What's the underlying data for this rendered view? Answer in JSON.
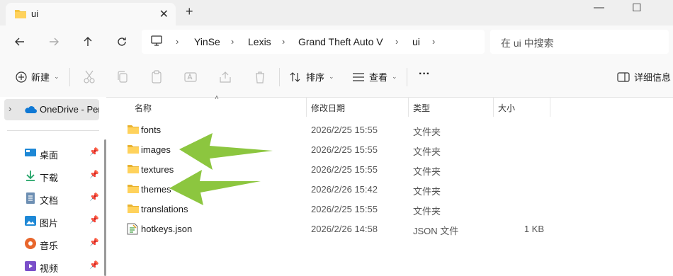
{
  "window": {
    "tab_title": "ui",
    "new_tab": "+",
    "minimize": "—",
    "maximize": "☐"
  },
  "nav": {
    "breadcrumbs": [
      "YinSe",
      "Lexis",
      "Grand Theft Auto V",
      "ui"
    ],
    "search_placeholder": "在 ui 中搜索"
  },
  "toolbar": {
    "new_label": "新建",
    "sort_label": "排序",
    "view_label": "查看",
    "more_label": "···",
    "details_label": "详细信息"
  },
  "sidebar": {
    "onedrive": "OneDrive - Per",
    "items": [
      {
        "label": "桌面",
        "icon": "desktop-icon"
      },
      {
        "label": "下载",
        "icon": "download-icon"
      },
      {
        "label": "文档",
        "icon": "document-icon"
      },
      {
        "label": "图片",
        "icon": "pictures-icon"
      },
      {
        "label": "音乐",
        "icon": "music-icon"
      },
      {
        "label": "视频",
        "icon": "video-icon"
      }
    ]
  },
  "columns": {
    "name": "名称",
    "modified": "修改日期",
    "type": "类型",
    "size": "大小"
  },
  "files": [
    {
      "name": "fonts",
      "modified": "2026/2/25 15:55",
      "type": "文件夹",
      "size": "",
      "icon": "folder-icon"
    },
    {
      "name": "images",
      "modified": "2026/2/25 15:55",
      "type": "文件夹",
      "size": "",
      "icon": "folder-icon"
    },
    {
      "name": "textures",
      "modified": "2026/2/25 15:55",
      "type": "文件夹",
      "size": "",
      "icon": "folder-icon"
    },
    {
      "name": "themes",
      "modified": "2026/2/26 15:42",
      "type": "文件夹",
      "size": "",
      "icon": "folder-icon"
    },
    {
      "name": "translations",
      "modified": "2026/2/25 15:55",
      "type": "文件夹",
      "size": "",
      "icon": "folder-icon"
    },
    {
      "name": "hotkeys.json",
      "modified": "2026/2/26 14:58",
      "type": "JSON 文件",
      "size": "1 KB",
      "icon": "json-file-icon"
    }
  ],
  "colors": {
    "folder": "#f5c542",
    "arrow": "#8cc63f",
    "accent": "#0067c0"
  }
}
